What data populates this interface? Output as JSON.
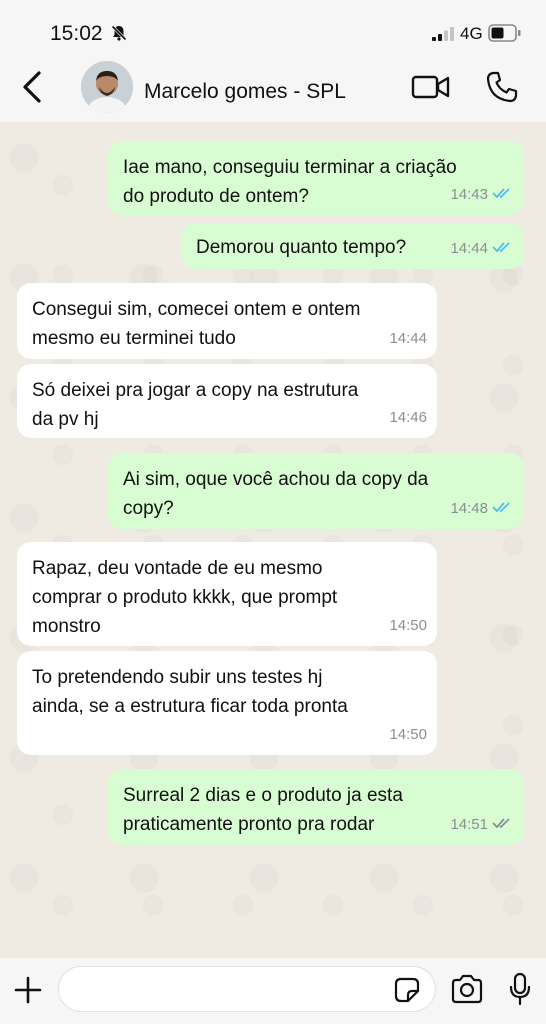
{
  "status_bar": {
    "time": "15:02",
    "network": "4G"
  },
  "header": {
    "contact_name": "Marcelo gomes - SPL"
  },
  "messages": [
    {
      "direction": "out",
      "text": "Iae mano, conseguiu terminar a criação\ndo produto de ontem?",
      "time": "14:43",
      "status": "read"
    },
    {
      "direction": "out",
      "text": "Demorou quanto tempo?",
      "time": "14:44",
      "status": "read"
    },
    {
      "direction": "in",
      "text": "Consegui sim, comecei ontem e ontem\nmesmo eu terminei tudo",
      "time": "14:44"
    },
    {
      "direction": "in",
      "text": "Só deixei pra jogar a copy na estrutura\nda pv hj",
      "time": "14:46"
    },
    {
      "direction": "out",
      "text": "Ai sim, oque você achou da copy da\ncopy?",
      "time": "14:48",
      "status": "read"
    },
    {
      "direction": "in",
      "text": "Rapaz, deu vontade de eu mesmo\ncomprar o produto kkkk, que prompt\nmonstro",
      "time": "14:50"
    },
    {
      "direction": "in",
      "text": "To pretendendo subir uns testes hj\nainda, se a estrutura ficar toda pronta",
      "time": "14:50"
    },
    {
      "direction": "out",
      "text": "Surreal 2 dias e o produto ja esta\npraticamente pronto pra rodar",
      "time": "14:51",
      "status": "delivered"
    }
  ],
  "input": {
    "value": "",
    "placeholder": ""
  },
  "colors": {
    "outgoing_bubble": "#d9fdd3",
    "incoming_bubble": "#ffffff",
    "read_tick": "#53bdeb",
    "delivered_tick": "#8a8f93",
    "chat_bg": "#efeae2"
  },
  "icons": {
    "status": [
      "bell-muted-icon",
      "signal-icon",
      "battery-icon"
    ],
    "header": [
      "back-chevron-icon",
      "video-call-icon",
      "phone-icon"
    ],
    "input": [
      "plus-icon",
      "sticker-icon",
      "camera-icon",
      "microphone-icon"
    ]
  }
}
